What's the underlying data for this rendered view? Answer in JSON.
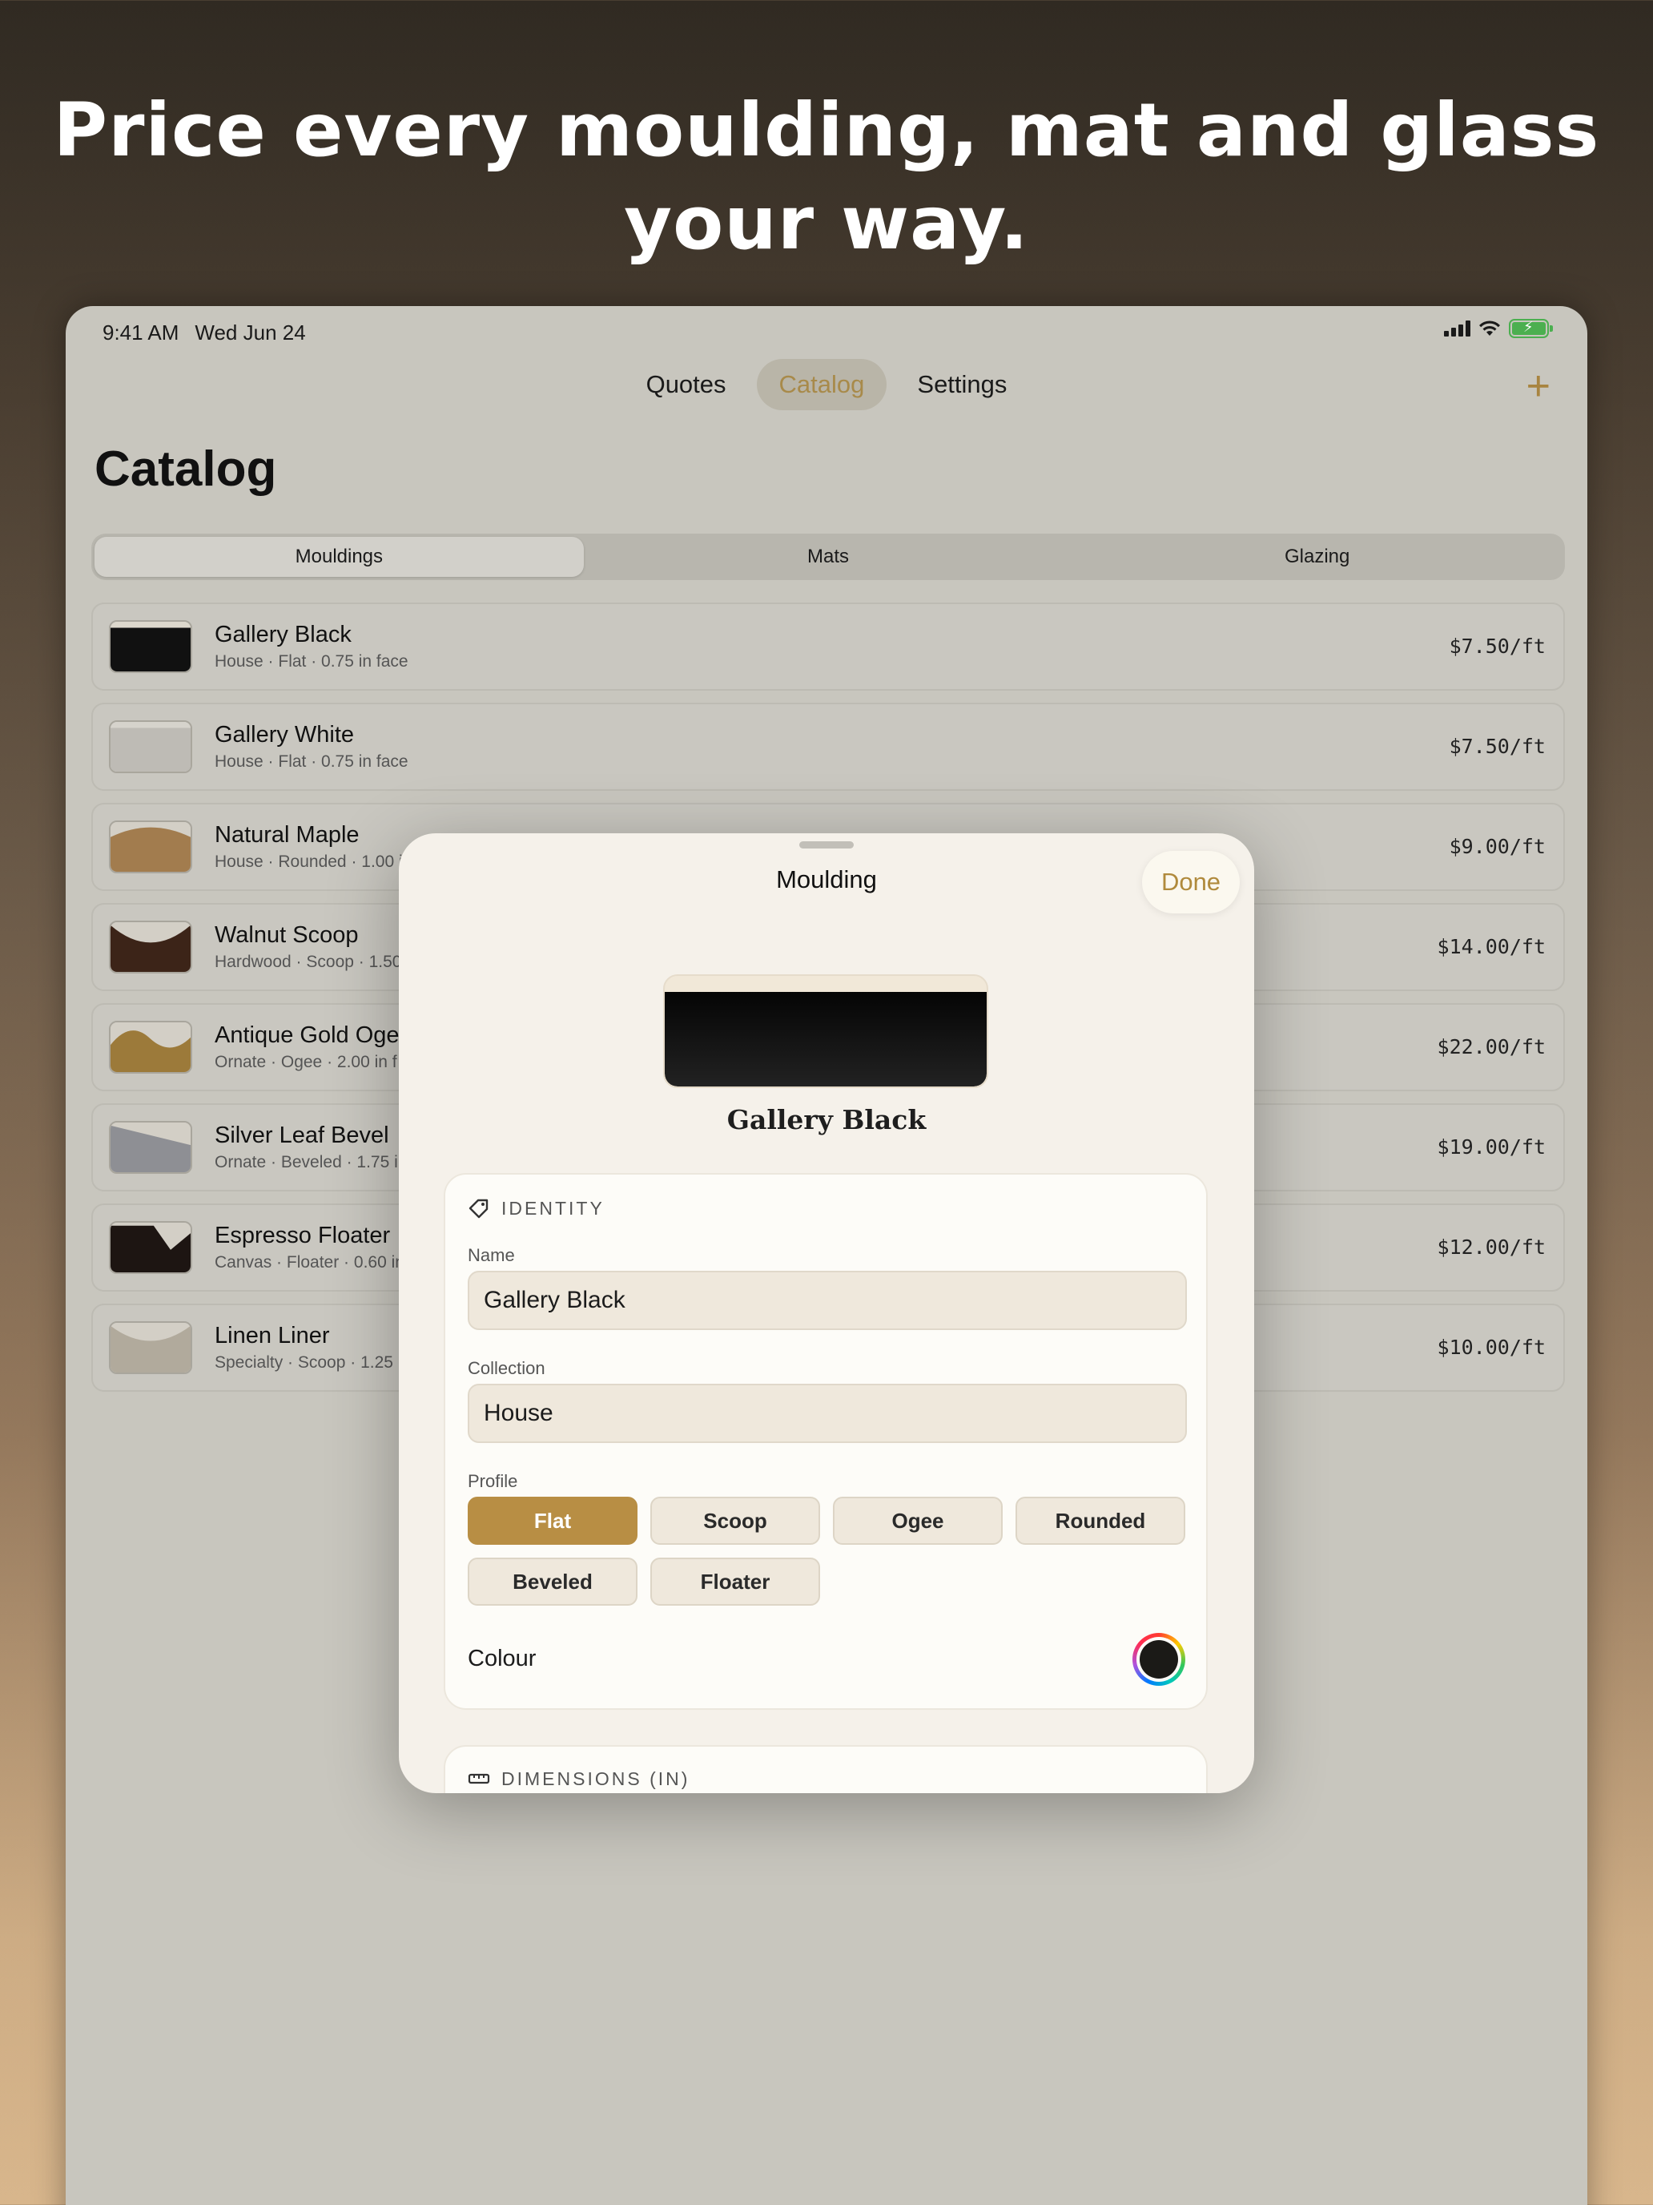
{
  "headline": "Price every moulding, mat and glass your way.",
  "status": {
    "time": "9:41 AM",
    "date": "Wed Jun 24"
  },
  "nav": {
    "tabs": [
      "Quotes",
      "Catalog",
      "Settings"
    ],
    "active": "Catalog",
    "add_label": "+"
  },
  "page_title": "Catalog",
  "segments": {
    "items": [
      "Mouldings",
      "Mats",
      "Glazing"
    ],
    "selected": "Mouldings"
  },
  "mouldings": [
    {
      "name": "Gallery Black",
      "meta": "House · Flat · 0.75 in face",
      "price": "$7.50/ft",
      "swatch": "flat-black"
    },
    {
      "name": "Gallery White",
      "meta": "House · Flat · 0.75 in face",
      "price": "$7.50/ft",
      "swatch": "flat-white"
    },
    {
      "name": "Natural Maple",
      "meta": "House · Rounded · 1.00 in",
      "price": "$9.00/ft",
      "swatch": "rounded-maple"
    },
    {
      "name": "Walnut Scoop",
      "meta": "Hardwood · Scoop · 1.50",
      "price": "$14.00/ft",
      "swatch": "scoop-walnut"
    },
    {
      "name": "Antique Gold Oge",
      "meta": "Ornate · Ogee · 2.00 in f",
      "price": "$22.00/ft",
      "swatch": "ogee-gold"
    },
    {
      "name": "Silver Leaf Bevel",
      "meta": "Ornate · Beveled · 1.75 in",
      "price": "$19.00/ft",
      "swatch": "bevel-silver"
    },
    {
      "name": "Espresso Floater",
      "meta": "Canvas · Floater · 0.60 in",
      "price": "$12.00/ft",
      "swatch": "floater-espresso"
    },
    {
      "name": "Linen Liner",
      "meta": "Specialty · Scoop · 1.25",
      "price": "$10.00/ft",
      "swatch": "scoop-linen"
    }
  ],
  "sheet": {
    "title": "Moulding",
    "done_label": "Done",
    "preview_name": "Gallery Black",
    "identity": {
      "heading": "IDENTITY",
      "name_label": "Name",
      "name_value": "Gallery Black",
      "collection_label": "Collection",
      "collection_value": "House",
      "profile_label": "Profile",
      "profiles": [
        "Flat",
        "Scoop",
        "Ogee",
        "Rounded",
        "Beveled",
        "Floater"
      ],
      "selected_profile": "Flat",
      "colour_label": "Colour",
      "colour_value": "#1b1a17"
    },
    "dimensions": {
      "heading": "DIMENSIONS (IN)"
    }
  },
  "colors": {
    "accent": "#b88e44",
    "sheet_bg": "#f5f1ea",
    "dim_bg": "#c8c6be"
  }
}
